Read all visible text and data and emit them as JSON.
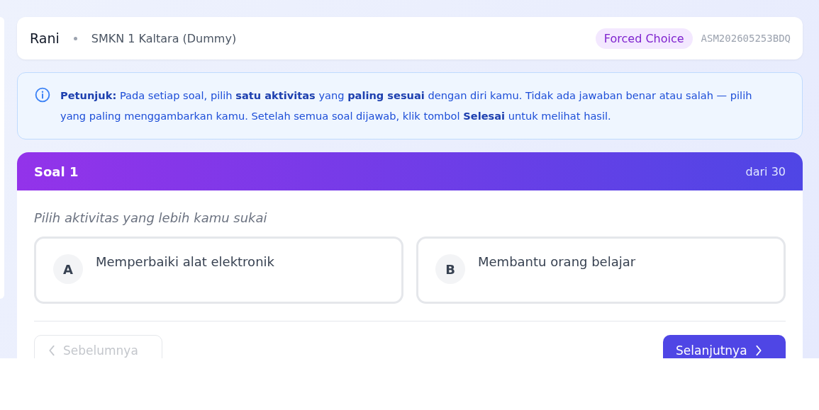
{
  "header": {
    "name": "Rani",
    "school": "SMKN 1 Kaltara (Dummy)",
    "badge": "Forced Choice",
    "code": "ASM202605253BDQ"
  },
  "instructions": "**Petunjuk:** Pada setiap soal, pilih **satu aktivitas** yang **paling sesuai** dengan diri kamu. Tidak ada jawaban benar atau salah — pilih yang paling menggambarkan kamu. Setelah semua soal dijawab, klik tombol **Selesai** untuk melihat hasil.",
  "question": {
    "title": "Soal 1",
    "total": "dari 30",
    "prompt": "Pilih aktivitas yang lebih kamu sukai",
    "options": [
      {
        "letter": "A",
        "text": "Memperbaiki alat elektronik",
        "selected": false
      },
      {
        "letter": "B",
        "text": "Membantu orang belajar",
        "selected": false
      }
    ]
  },
  "nav": {
    "prev": {
      "label": "Sebelumnya",
      "disabled": true
    },
    "next": {
      "label": "Selanjutnya",
      "disabled": false
    }
  }
}
